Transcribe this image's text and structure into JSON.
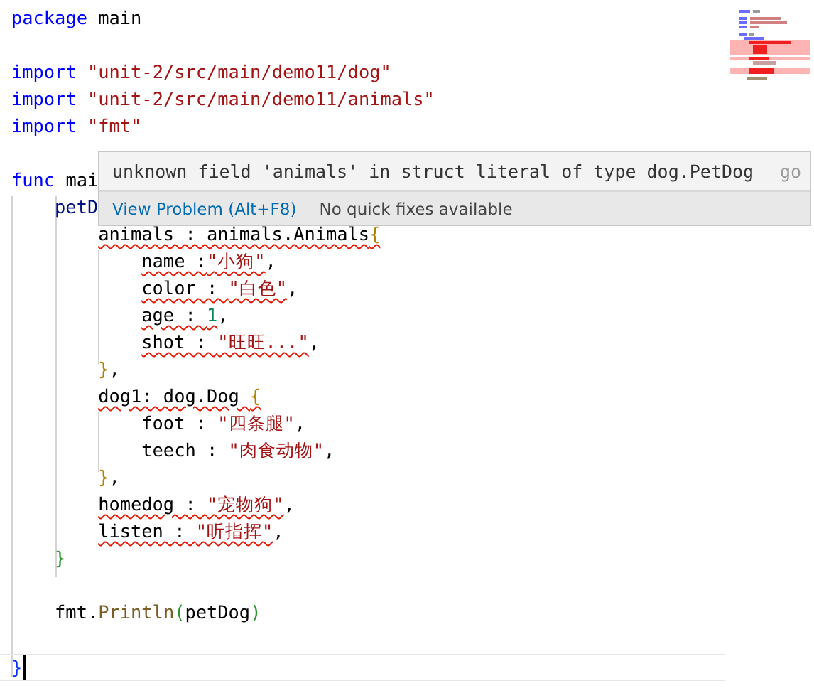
{
  "editor": {
    "lines": [
      {
        "current": false,
        "tokens": [
          {
            "text": "package",
            "kind": "keyword",
            "error": false
          },
          {
            "text": " main",
            "kind": "plain",
            "error": false
          }
        ]
      },
      {
        "current": false
      },
      {
        "current": false,
        "tokens": [
          {
            "text": "import",
            "kind": "keyword",
            "error": false
          },
          {
            "text": " \"unit-2/src/main/demo11/dog\"",
            "kind": "string",
            "error": false
          }
        ]
      },
      {
        "current": false,
        "tokens": [
          {
            "text": "import",
            "kind": "keyword",
            "error": false
          },
          {
            "text": " \"unit-2/src/main/demo11/animals\"",
            "kind": "string",
            "error": false
          }
        ]
      },
      {
        "current": false,
        "tokens": [
          {
            "text": "import",
            "kind": "keyword",
            "error": false
          },
          {
            "text": " \"fmt\"",
            "kind": "string",
            "error": false
          }
        ]
      },
      {
        "current": false
      },
      {
        "current": false,
        "tokens": [
          {
            "text": "func",
            "kind": "keyword",
            "error": false
          },
          {
            "text": " mai",
            "kind": "plain",
            "error": false
          }
        ],
        "children": [
          {
            "current": false,
            "tokens": [
              {
                "text": "petD",
                "kind": "variable",
                "error": false
              }
            ],
            "children": [
              {
                "current": false,
                "tokens": [
                  {
                    "text": "animals : animals.Animals",
                    "kind": "plain",
                    "error": true
                  },
                  {
                    "text": "{",
                    "kind": "bracket3",
                    "error": true
                  }
                ],
                "children": [
                  {
                    "current": false,
                    "tokens": [
                      {
                        "text": "name :",
                        "kind": "plain",
                        "error": true
                      },
                      {
                        "text": "\"小狗\"",
                        "kind": "string",
                        "error": true
                      },
                      {
                        "text": ",",
                        "kind": "plain",
                        "error": false
                      }
                    ]
                  },
                  {
                    "current": false,
                    "tokens": [
                      {
                        "text": "color : ",
                        "kind": "plain",
                        "error": true
                      },
                      {
                        "text": "\"白色\"",
                        "kind": "string",
                        "error": true
                      },
                      {
                        "text": ",",
                        "kind": "plain",
                        "error": false
                      }
                    ]
                  },
                  {
                    "current": false,
                    "tokens": [
                      {
                        "text": "age : ",
                        "kind": "plain",
                        "error": true
                      },
                      {
                        "text": "1",
                        "kind": "number",
                        "error": true
                      },
                      {
                        "text": ",",
                        "kind": "plain",
                        "error": false
                      }
                    ]
                  },
                  {
                    "current": false,
                    "tokens": [
                      {
                        "text": "shot : ",
                        "kind": "plain",
                        "error": true
                      },
                      {
                        "text": "\"旺旺...\"",
                        "kind": "string",
                        "error": true
                      },
                      {
                        "text": ",",
                        "kind": "plain",
                        "error": false
                      }
                    ]
                  }
                ]
              },
              {
                "current": false,
                "tokens": [
                  {
                    "text": "}",
                    "kind": "bracket3",
                    "error": false
                  },
                  {
                    "text": ",",
                    "kind": "plain",
                    "error": false
                  }
                ]
              },
              {
                "current": false,
                "tokens": [
                  {
                    "text": "dog1: dog.Dog ",
                    "kind": "plain",
                    "error": true
                  },
                  {
                    "text": "{",
                    "kind": "bracket3",
                    "error": true
                  }
                ],
                "children": [
                  {
                    "current": false,
                    "tokens": [
                      {
                        "text": "foot : ",
                        "kind": "plain",
                        "error": false
                      },
                      {
                        "text": "\"四条腿\"",
                        "kind": "string",
                        "error": false
                      },
                      {
                        "text": ",",
                        "kind": "plain",
                        "error": false
                      }
                    ]
                  },
                  {
                    "current": false,
                    "tokens": [
                      {
                        "text": "teech : ",
                        "kind": "plain",
                        "error": false
                      },
                      {
                        "text": "\"肉食动物\"",
                        "kind": "string",
                        "error": false
                      },
                      {
                        "text": ",",
                        "kind": "plain",
                        "error": false
                      }
                    ]
                  }
                ]
              },
              {
                "current": false,
                "tokens": [
                  {
                    "text": "}",
                    "kind": "bracket3",
                    "error": false
                  },
                  {
                    "text": ",",
                    "kind": "plain",
                    "error": false
                  }
                ]
              },
              {
                "current": false,
                "tokens": [
                  {
                    "text": "homedog : ",
                    "kind": "plain",
                    "error": true
                  },
                  {
                    "text": "\"宠物狗\"",
                    "kind": "string",
                    "error": true
                  },
                  {
                    "text": ",",
                    "kind": "plain",
                    "error": false
                  }
                ]
              },
              {
                "current": false,
                "tokens": [
                  {
                    "text": "listen : ",
                    "kind": "plain",
                    "error": true
                  },
                  {
                    "text": "\"听指挥\"",
                    "kind": "string",
                    "error": true
                  },
                  {
                    "text": ",",
                    "kind": "plain",
                    "error": false
                  }
                ]
              }
            ]
          },
          {
            "current": false,
            "tokens": [
              {
                "text": "}",
                "kind": "bracket2",
                "error": false
              }
            ]
          },
          {
            "current": false
          },
          {
            "current": false,
            "tokens": [
              {
                "text": "fmt.",
                "kind": "plain",
                "error": false
              },
              {
                "text": "Println",
                "kind": "function",
                "error": false
              },
              {
                "text": "(",
                "kind": "bracket2",
                "error": false
              },
              {
                "text": "petDog",
                "kind": "plain",
                "error": false
              },
              {
                "text": ")",
                "kind": "bracket2",
                "error": false
              }
            ]
          }
        ]
      },
      {
        "current": false
      },
      {
        "current": true,
        "tokens": [
          {
            "text": "}",
            "kind": "bracket1",
            "error": false
          }
        ]
      }
    ]
  },
  "hover": {
    "message": "unknown field 'animals' in struct literal of type dog.PetDog",
    "source": "go",
    "action": "View Problem (Alt+F8)",
    "note": "No quick fixes available"
  }
}
